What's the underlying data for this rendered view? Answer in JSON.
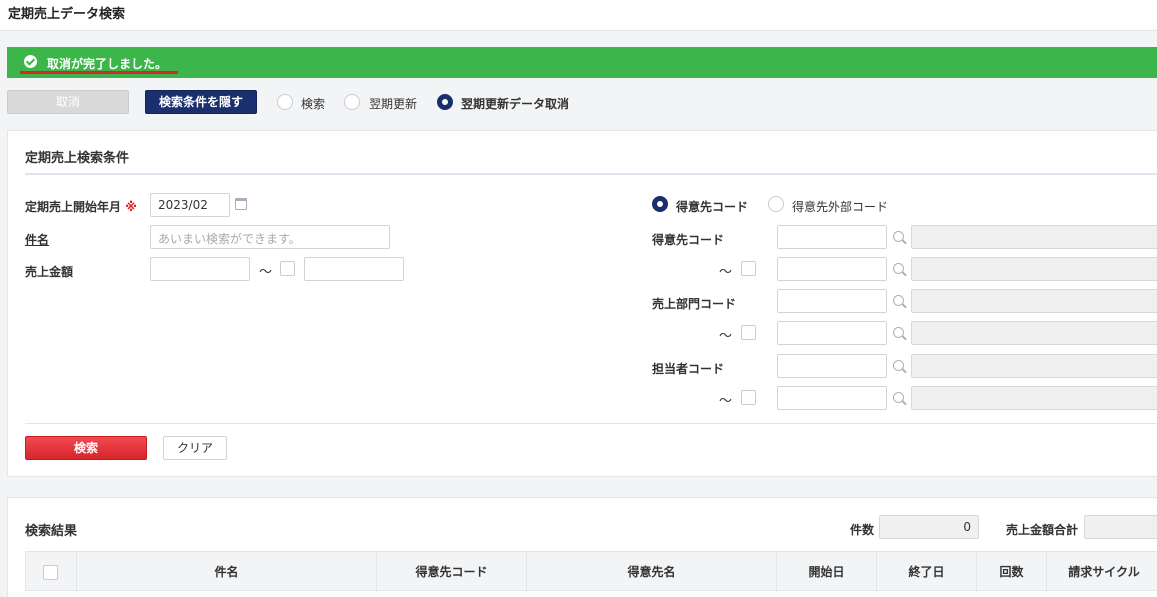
{
  "page": {
    "title": "定期売上データ検索"
  },
  "alert": {
    "message": "取消が完了しました。"
  },
  "toolbar": {
    "cancel_label": "取消",
    "hide_conditions_label": "検索条件を隠す",
    "modes": [
      {
        "label": "検索",
        "selected": false
      },
      {
        "label": "翌期更新",
        "selected": false
      },
      {
        "label": "翌期更新データ取消",
        "selected": true
      }
    ]
  },
  "conditions": {
    "title": "定期売上検索条件",
    "start_month_label": "定期売上開始年月",
    "required_mark": "※",
    "start_month_value": "2023/02",
    "subject_label": "件名",
    "subject_placeholder": "あいまい検索ができます。",
    "amount_label": "売上金額",
    "tilde": "～",
    "code_type_options": [
      {
        "label": "得意先コード",
        "selected": true
      },
      {
        "label": "得意先外部コード",
        "selected": false
      }
    ],
    "customer_code_label": "得意先コード",
    "sales_dept_code_label": "売上部門コード",
    "staff_code_label": "担当者コード",
    "search_label": "検索",
    "clear_label": "クリア"
  },
  "results": {
    "title": "検索結果",
    "count_label": "件数",
    "count_value": "0",
    "total_label": "売上金額合計",
    "columns": [
      "件名",
      "得意先コード",
      "得意先名",
      "開始日",
      "終了日",
      "回数",
      "請求サイクル"
    ]
  }
}
